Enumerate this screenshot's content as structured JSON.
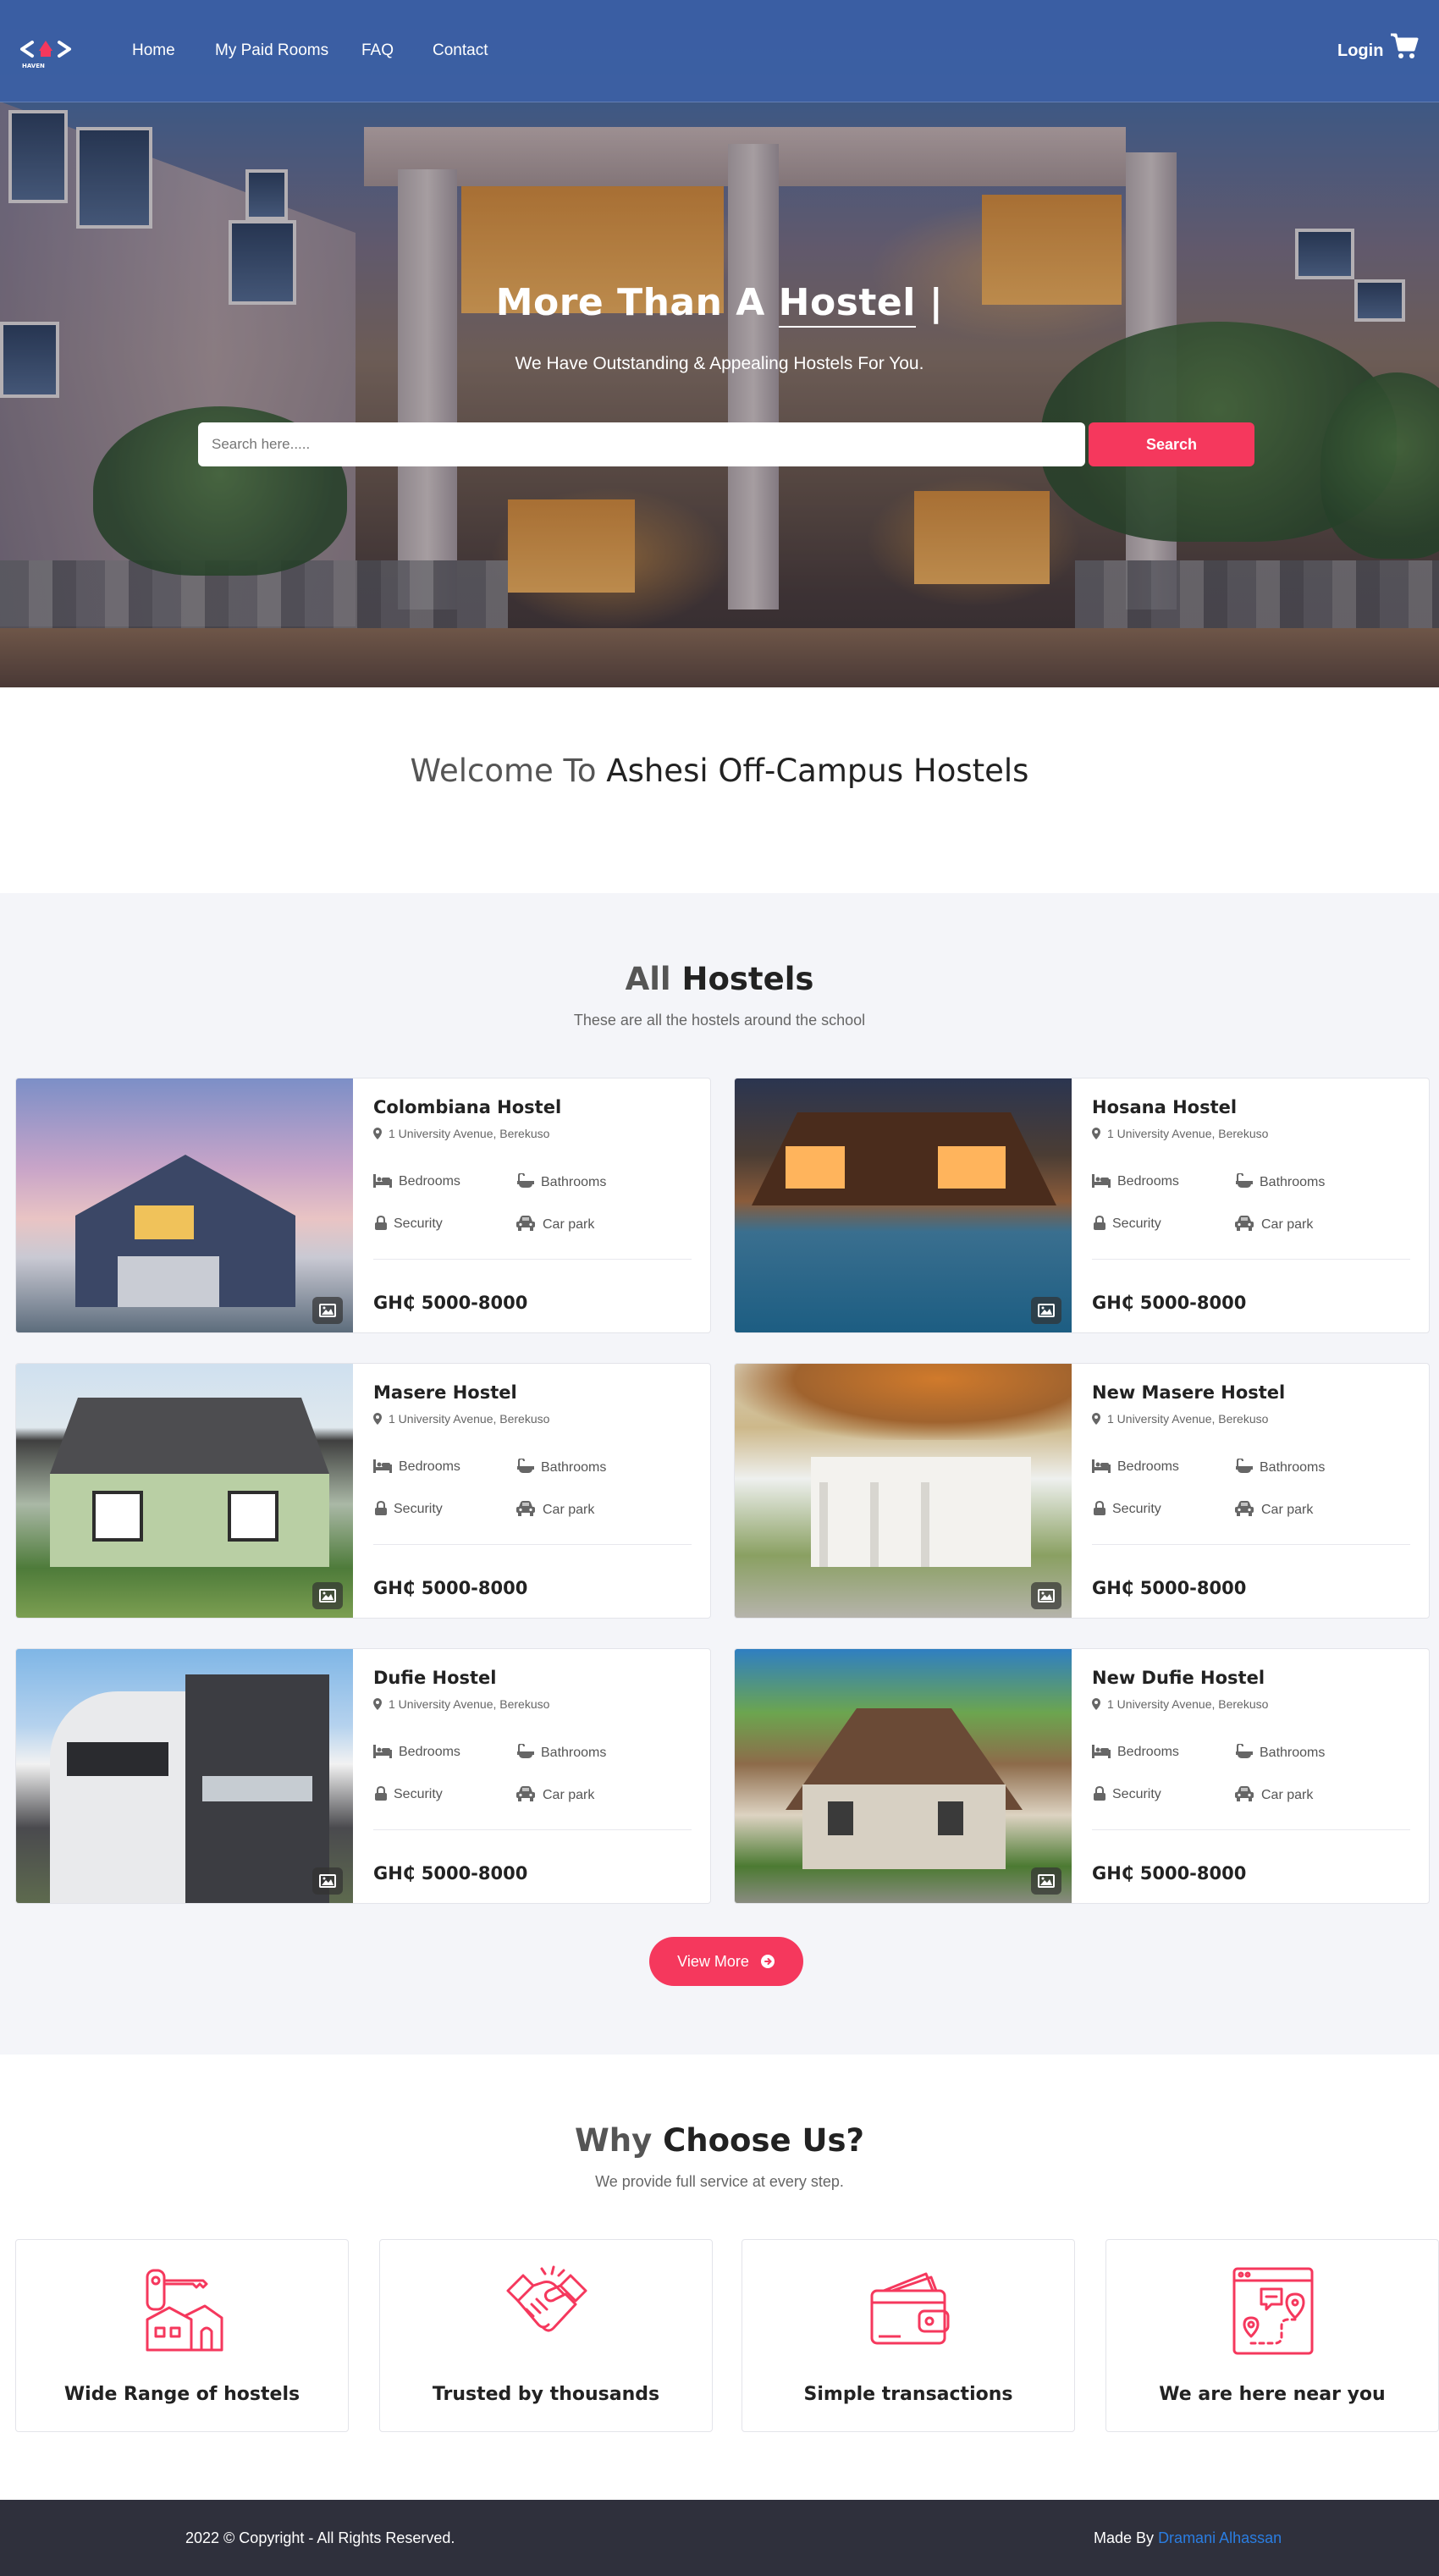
{
  "colors": {
    "accent": "#f5385d",
    "nav_bg": "#3c62aa",
    "footer_bg": "#2f303c",
    "section_bg": "#f4f5f9",
    "link": "#2a7de1"
  },
  "nav": {
    "logo_text": "HAVEN",
    "links": [
      "Home",
      "My Paid Rooms",
      "FAQ",
      "Contact"
    ],
    "login": "Login",
    "cart_icon": "shopping-cart-icon"
  },
  "hero": {
    "title_prefix": "More Than A",
    "title_typed": "Hostel",
    "cursor": "|",
    "subtitle": "We Have Outstanding & Appealing Hostels For You.",
    "search_placeholder": "Search here.....",
    "search_button": "Search"
  },
  "welcome": {
    "prefix": "Welcome To",
    "highlight": "Ashesi Off-Campus Hostels"
  },
  "hostels": {
    "title_prefix": "All",
    "title_highlight": "Hostels",
    "subtitle": "These are all the hostels around the school",
    "feature_labels": {
      "bedrooms": "Bedrooms",
      "bathrooms": "Bathrooms",
      "security": "Security",
      "carpark": "Car park"
    },
    "items": [
      {
        "name": "Colombiana Hostel",
        "address": "1 University Avenue, Berekuso",
        "price": "GH₵ 5000-8000"
      },
      {
        "name": "Hosana Hostel",
        "address": "1 University Avenue, Berekuso",
        "price": "GH₵ 5000-8000"
      },
      {
        "name": "Masere Hostel",
        "address": "1 University Avenue, Berekuso",
        "price": "GH₵ 5000-8000"
      },
      {
        "name": "New Masere Hostel",
        "address": "1 University Avenue, Berekuso",
        "price": "GH₵ 5000-8000"
      },
      {
        "name": "Dufie Hostel",
        "address": "1 University Avenue, Berekuso",
        "price": "GH₵ 5000-8000"
      },
      {
        "name": "New Dufie Hostel",
        "address": "1 University Avenue, Berekuso",
        "price": "GH₵ 5000-8000"
      }
    ],
    "view_more": "View More"
  },
  "why": {
    "title_prefix": "Why",
    "title_highlight": "Choose Us?",
    "subtitle": "We provide full service at every step.",
    "items": [
      {
        "label": "Wide Range of hostels",
        "icon": "house-key-icon"
      },
      {
        "label": "Trusted by thousands",
        "icon": "handshake-icon"
      },
      {
        "label": "Simple transactions",
        "icon": "wallet-icon"
      },
      {
        "label": "We are here near you",
        "icon": "map-location-icon"
      }
    ]
  },
  "footer": {
    "copyright": "2022 © Copyright - All Rights Reserved.",
    "made_by": "Made By",
    "author": "Dramani Alhassan"
  }
}
